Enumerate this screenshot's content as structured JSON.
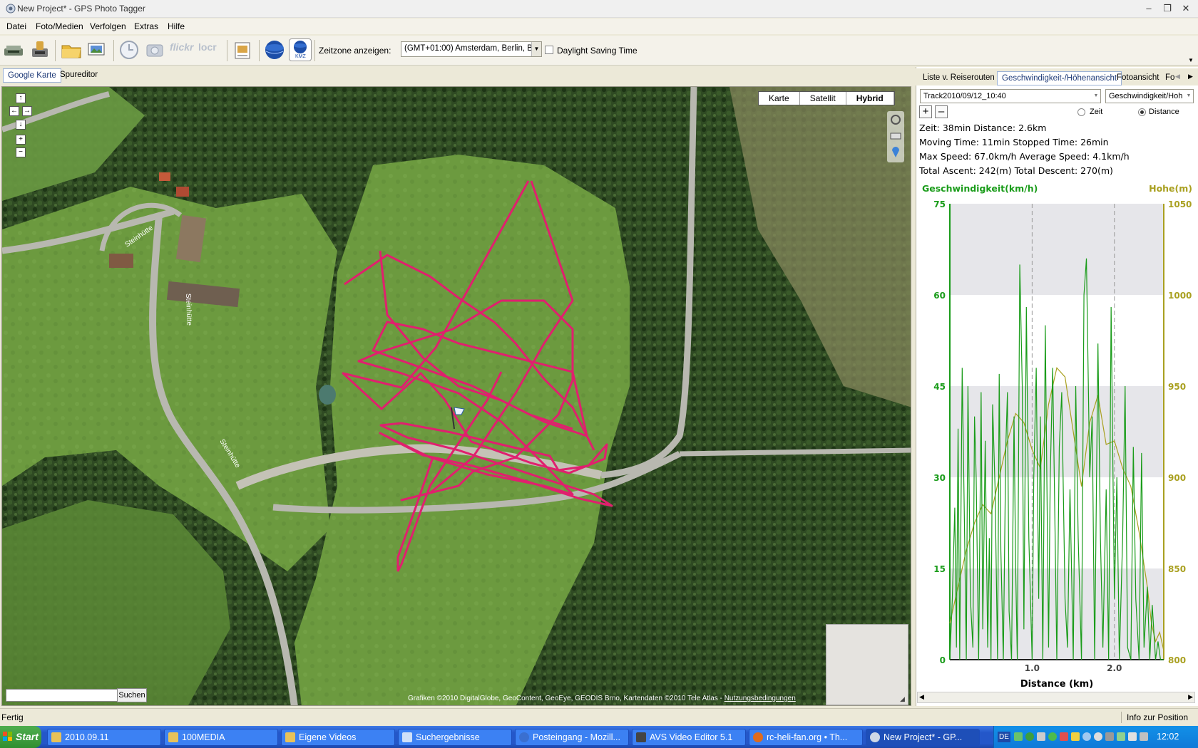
{
  "window": {
    "title": "New Project* - GPS Photo Tagger",
    "minimize": "–",
    "maximize": "❐",
    "close": "✕"
  },
  "menu": [
    "Datei",
    "Foto/Medien",
    "Verfolgen",
    "Extras",
    "Hilfe"
  ],
  "toolbar": {
    "timezone_label": "Zeitzone anzeigen:",
    "timezone_value": "(GMT+01:00) Amsterdam, Berlin, Bern",
    "dst_label": "Daylight Saving Time",
    "flickr_label": "flickr",
    "locr_label": "locr",
    "kmz_label": "KMZ"
  },
  "left_tabs": [
    "Google Karte",
    "Spureditor"
  ],
  "map": {
    "types": [
      "Karte",
      "Satellit",
      "Hybrid"
    ],
    "selected_type": "Hybrid",
    "search_button": "Suchen",
    "copyright": "Grafiken ©2010 DigitalGlobe, GeoContent, GeoEye, GEODIS Brno, Kartendaten ©2010 Tele Atlas - ",
    "terms_link": "Nutzungsbedingungen",
    "road_label": "Steinhütte",
    "track_color": "#e0206e"
  },
  "right_tabs": [
    "Liste v. Reiserouten",
    "Geschwindigkeit-/Höhenansicht",
    "Fotoansicht",
    "Fo"
  ],
  "right_tab_active": 1,
  "chart_controls": {
    "track": "Track2010/09/12_10:40",
    "metric": "Geschwindigkeit/Hoh",
    "add": "+",
    "remove": "–",
    "radio_time": "Zeit",
    "radio_distance": "Distance",
    "selected": "Distance"
  },
  "stats": {
    "line1": "Zeit: 38min   Distance: 2.6km",
    "line2": "Moving Time: 11min   Stopped Time: 26min",
    "line3": "Max Speed: 67.0km/h   Average Speed: 4.1km/h",
    "line4": "Total Ascent: 242(m)   Total Descent: 270(m)"
  },
  "chart_data": {
    "type": "line",
    "xlabel": "Distance (km)",
    "x_ticks": [
      "1.0",
      "2.0"
    ],
    "xlim": [
      0,
      2.6
    ],
    "y_left_label": "Geschwindigkeit(km/h)",
    "y_left_ticks": [
      "75",
      "60",
      "45",
      "30",
      "15",
      "0"
    ],
    "y_left_lim": [
      0,
      75
    ],
    "y_right_label": "Hohe(m)",
    "y_right_ticks": [
      "1050",
      "1000",
      "950",
      "900",
      "850",
      "800"
    ],
    "y_right_lim": [
      800,
      1050
    ],
    "colors": {
      "speed": "#1a9c1a",
      "elevation": "#a9a020"
    },
    "series": [
      {
        "name": "Geschwindigkeit(km/h)",
        "x": [
          0.0,
          0.03,
          0.06,
          0.08,
          0.1,
          0.12,
          0.15,
          0.18,
          0.2,
          0.22,
          0.25,
          0.28,
          0.3,
          0.32,
          0.35,
          0.38,
          0.4,
          0.43,
          0.46,
          0.48,
          0.5,
          0.52,
          0.55,
          0.58,
          0.6,
          0.62,
          0.65,
          0.68,
          0.7,
          0.72,
          0.75,
          0.78,
          0.8,
          0.82,
          0.85,
          0.88,
          0.9,
          0.93,
          0.96,
          1.0,
          1.02,
          1.05,
          1.08,
          1.1,
          1.13,
          1.16,
          1.2,
          1.22,
          1.25,
          1.28,
          1.3,
          1.33,
          1.36,
          1.4,
          1.43,
          1.46,
          1.5,
          1.53,
          1.56,
          1.6,
          1.63,
          1.66,
          1.7,
          1.73,
          1.76,
          1.8,
          1.83,
          1.86,
          1.9,
          1.93,
          1.96,
          2.0,
          2.03,
          2.06,
          2.1,
          2.13,
          2.16,
          2.2,
          2.23,
          2.26,
          2.3,
          2.33,
          2.36,
          2.4,
          2.43,
          2.46,
          2.5,
          2.53,
          2.56,
          2.6
        ],
        "y": [
          0,
          10,
          25,
          2,
          38,
          0,
          48,
          20,
          0,
          45,
          10,
          2,
          40,
          30,
          0,
          44,
          5,
          36,
          2,
          20,
          0,
          42,
          28,
          0,
          47,
          18,
          0,
          35,
          44,
          8,
          0,
          40,
          15,
          0,
          65,
          45,
          5,
          58,
          20,
          0,
          30,
          48,
          10,
          40,
          0,
          55,
          2,
          30,
          48,
          20,
          0,
          35,
          44,
          10,
          2,
          28,
          0,
          45,
          20,
          0,
          60,
          66,
          30,
          40,
          0,
          52,
          20,
          2,
          28,
          0,
          58,
          10,
          30,
          0,
          20,
          45,
          2,
          0,
          35,
          10,
          0,
          34,
          2,
          12,
          0,
          9,
          0,
          3,
          0,
          0
        ]
      },
      {
        "name": "Hohe(m)",
        "x": [
          0.0,
          0.1,
          0.2,
          0.3,
          0.4,
          0.5,
          0.6,
          0.7,
          0.8,
          0.9,
          1.0,
          1.1,
          1.2,
          1.3,
          1.4,
          1.5,
          1.6,
          1.7,
          1.8,
          1.9,
          2.0,
          2.1,
          2.2,
          2.3,
          2.4,
          2.45,
          2.5,
          2.55,
          2.6
        ],
        "y": [
          820,
          840,
          860,
          875,
          885,
          880,
          900,
          920,
          935,
          930,
          915,
          905,
          940,
          960,
          955,
          925,
          895,
          930,
          945,
          918,
          920,
          905,
          895,
          870,
          840,
          820,
          810,
          815,
          805
        ]
      }
    ]
  },
  "status": {
    "left": "Fertig",
    "right": "Info zur Position"
  },
  "taskbar": {
    "start": "Start",
    "tasks": [
      "2010.09.11",
      "100MEDIA",
      "Eigene Videos",
      "Suchergebnisse",
      "Posteingang - Mozill...",
      "AVS Video Editor 5.1",
      "rc-heli-fan.org • Th...",
      "New Project* - GP..."
    ],
    "active_task": 7,
    "lang": "DE",
    "clock": "12:02"
  }
}
